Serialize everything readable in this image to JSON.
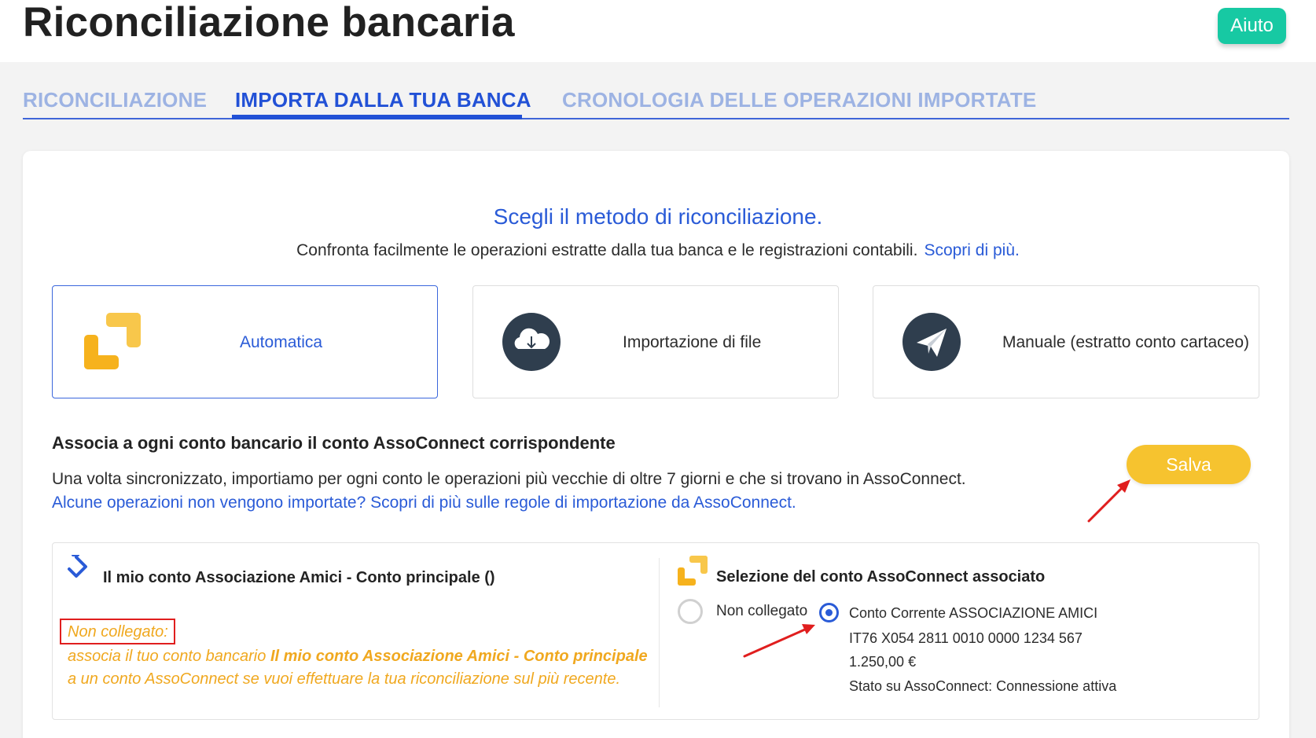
{
  "header": {
    "title": "Riconciliazione bancaria",
    "help_label": "Aiuto"
  },
  "tabs": [
    {
      "label": "RICONCILIAZIONE",
      "active": false
    },
    {
      "label": "IMPORTA DALLA TUA BANCA",
      "active": true
    },
    {
      "label": "CRONOLOGIA DELLE OPERAZIONI IMPORTATE",
      "active": false
    }
  ],
  "method": {
    "title": "Scegli il metodo di riconciliazione.",
    "subtitle": "Confronta facilmente le operazioni estratte dalla tua banca e le registrazioni contabili.",
    "learn_more": "Scopri di più.",
    "options": [
      {
        "label": "Automatica",
        "icon": "assoconnect-logo-icon",
        "selected": true
      },
      {
        "label": "Importazione di file",
        "icon": "cloud-download-icon",
        "selected": false
      },
      {
        "label": "Manuale (estratto conto cartaceo)",
        "icon": "paper-plane-icon",
        "selected": false
      }
    ]
  },
  "association": {
    "title": "Associa a ogni conto bancario il conto AssoConnect corrispondente",
    "description": "Una volta sincronizzato, importiamo per ogni conto le operazioni più vecchie di oltre 7 giorni e che si trovano in AssoConnect.",
    "link": "Alcune operazioni non vengono importate? Scopri di più sulle regole di importazione da AssoConnect.",
    "save_label": "Salva"
  },
  "bank_account": {
    "name": "Il mio conto Associazione Amici - Conto principale ()",
    "status": "Non collegato:",
    "warning_prefix": "associa il tuo conto bancario ",
    "warning_bold": "Il mio conto Associazione Amici - Conto principale",
    "warning_line2": "a un conto AssoConnect se vuoi effettuare la tua riconciliazione sul più recente."
  },
  "assoconnect_selection": {
    "title": "Selezione del conto AssoConnect associato",
    "not_linked_label": "Non collegato",
    "account": {
      "name": "Conto Corrente ASSOCIAZIONE AMICI",
      "iban": "IT76 X054 2811 0010 0000 1234 567",
      "balance": "1.250,00 €",
      "state": "Stato su AssoConnect: Connessione attiva"
    }
  },
  "colors": {
    "primary_blue": "#2251d6",
    "accent_green": "#17c9a3",
    "save_yellow": "#f6c32f",
    "warning_orange": "#f0a81f",
    "annotation_red": "#e01e1e"
  }
}
